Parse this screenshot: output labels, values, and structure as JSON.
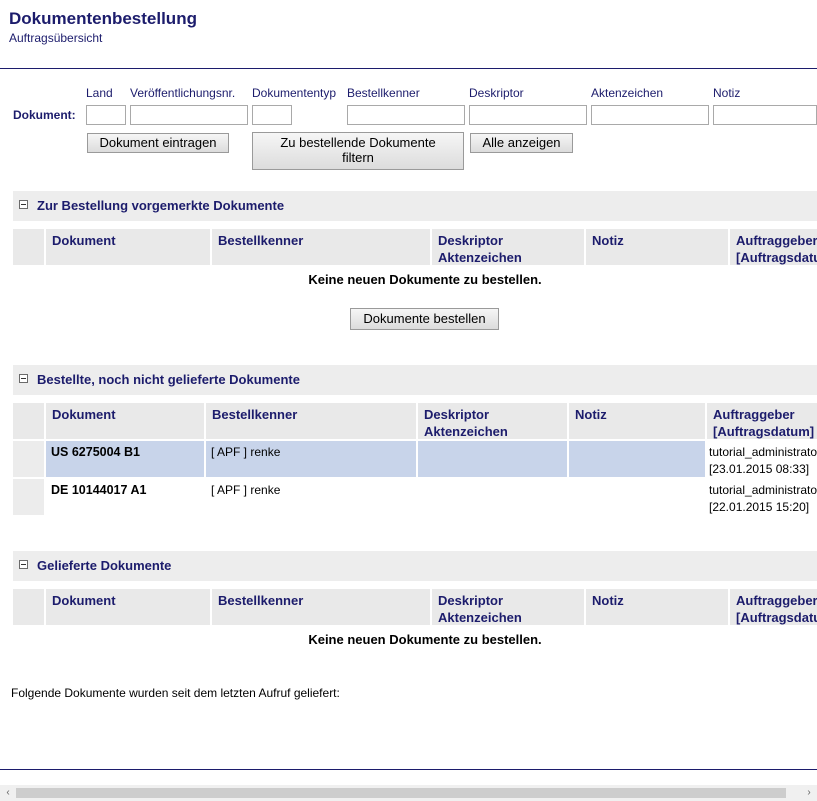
{
  "header": {
    "title": "Dokumentenbestellung",
    "subtitle": "Auftragsübersicht"
  },
  "form": {
    "dokument_label": "Dokument:",
    "fields": {
      "land": "Land",
      "veroeffentlichungsnr": "Veröffentlichungsnr.",
      "dokumententyp": "Dokumententyp",
      "bestellkenner": "Bestellkenner",
      "deskriptor": "Deskriptor",
      "aktenzeichen": "Aktenzeichen",
      "notiz": "Notiz"
    },
    "buttons": {
      "eintragen": "Dokument eintragen",
      "filtern": "Zu bestellende Dokumente filtern",
      "alle": "Alle anzeigen"
    }
  },
  "columns": {
    "dokument": "Dokument",
    "bestellkenner": "Bestellkenner",
    "deskriptor": "Deskriptor",
    "aktenzeichen": "Aktenzeichen",
    "notiz": "Notiz",
    "auftraggeber": "Auftraggeber",
    "auftragsdatum": "[Auftragsdatum]"
  },
  "sections": {
    "vorgemerkt": {
      "title": "Zur Bestellung vorgemerkte Dokumente",
      "empty": "Keine neuen Dokumente zu bestellen.",
      "button": "Dokumente bestellen"
    },
    "bestellt": {
      "title": "Bestellte, noch nicht gelieferte Dokumente",
      "rows": [
        {
          "dokument": "US 6275004 B1",
          "bestellkenner": "[ APF ] renke",
          "deskriptor": "",
          "notiz": "",
          "auftraggeber": "tutorial_administrator",
          "datum": "[23.01.2015 08:33]"
        },
        {
          "dokument": "DE 10144017 A1",
          "bestellkenner": "[ APF ] renke",
          "deskriptor": "",
          "notiz": "",
          "auftraggeber": "tutorial_administrator",
          "datum": "[22.01.2015 15:20]"
        }
      ]
    },
    "geliefert": {
      "title": "Gelieferte Dokumente",
      "empty": "Keine neuen Dokumente zu bestellen."
    }
  },
  "info": "Folgende Dokumente wurden seit dem letzten Aufruf geliefert:",
  "scrollbar": {
    "left_arrow": "‹",
    "right_arrow": "›"
  }
}
